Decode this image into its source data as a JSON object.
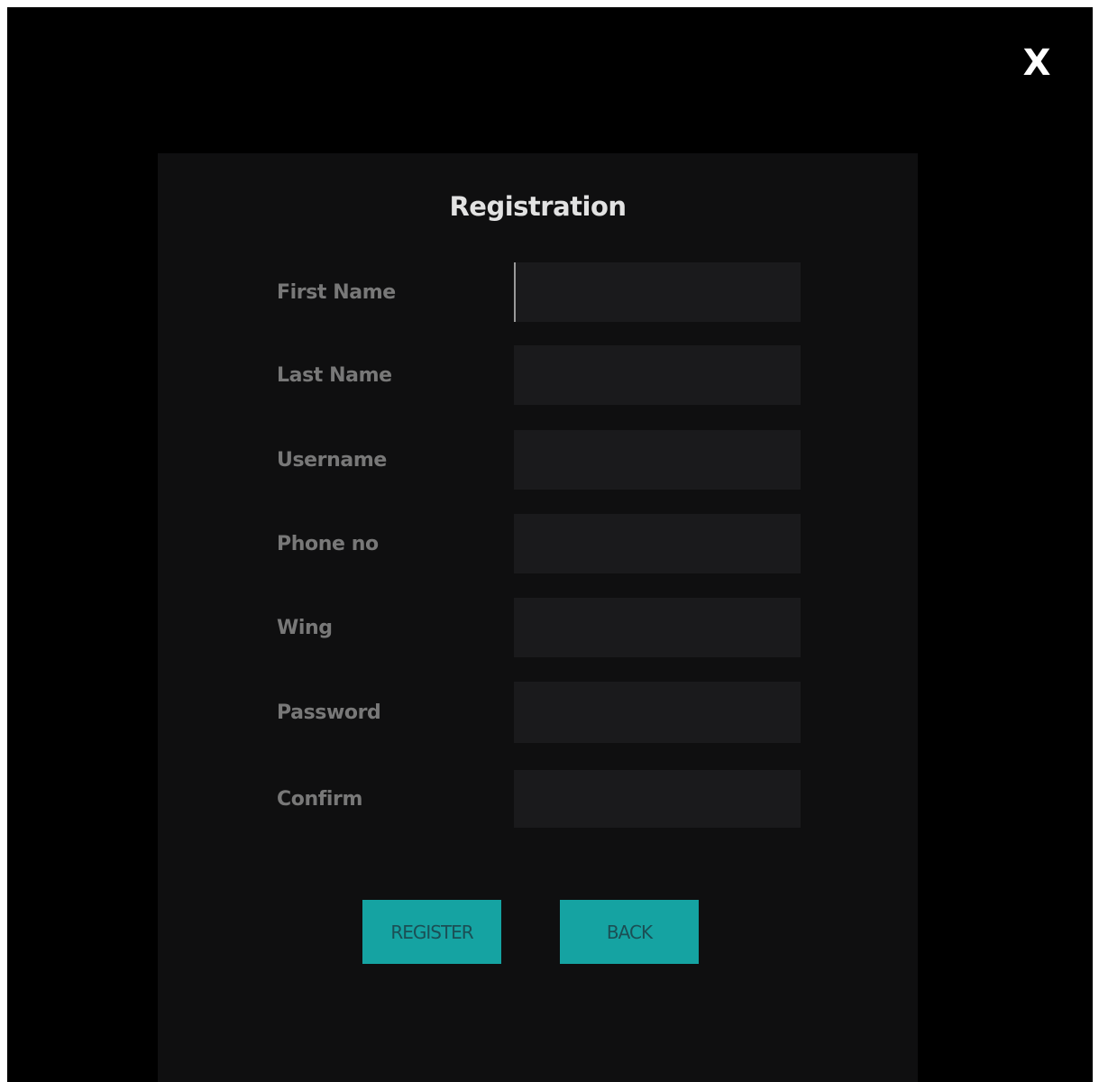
{
  "window": {
    "close_label": "X"
  },
  "form": {
    "title": "Registration",
    "fields": [
      {
        "label": "First Name",
        "value": ""
      },
      {
        "label": "Last Name",
        "value": ""
      },
      {
        "label": "Username",
        "value": ""
      },
      {
        "label": "Phone no",
        "value": ""
      },
      {
        "label": "Wing",
        "value": ""
      },
      {
        "label": "Password",
        "value": ""
      },
      {
        "label": "Confirm",
        "value": ""
      }
    ],
    "register_label": "REGISTER",
    "back_label": "BACK"
  },
  "colors": {
    "background": "#000000",
    "panel": "#0f0f10",
    "input": "#1a1a1c",
    "label": "#787878",
    "title": "#e2e2e2",
    "button": "#15a3a2",
    "button_text": "#1b4f55"
  }
}
